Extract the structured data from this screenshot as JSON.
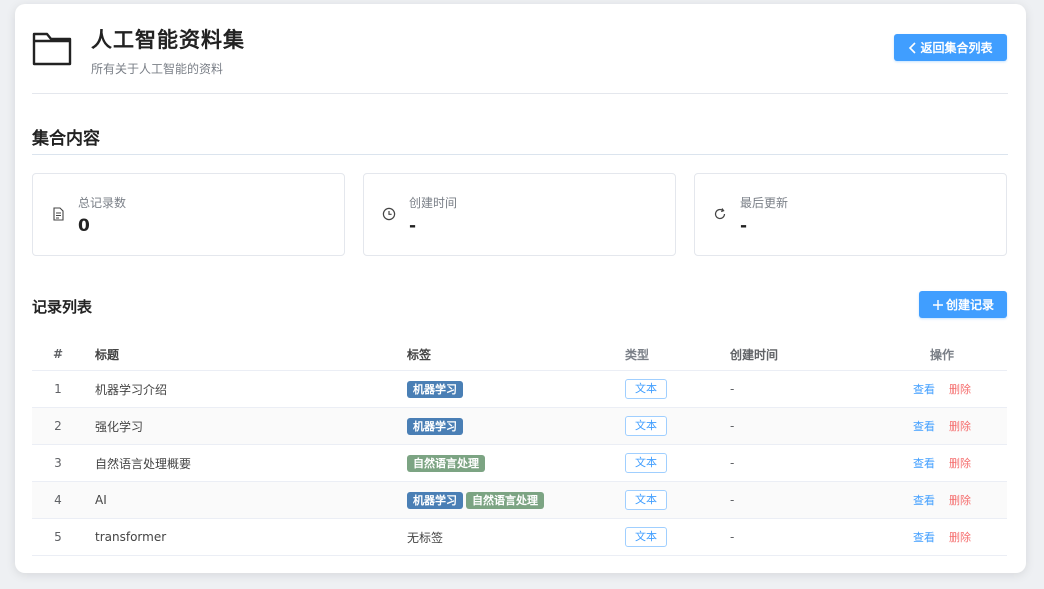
{
  "header": {
    "title": "人工智能资料集",
    "subtitle": "所有关于人工智能的资料",
    "back_label": "返回集合列表"
  },
  "section": {
    "title": "集合内容"
  },
  "stats": [
    {
      "label": "总记录数",
      "value": "0",
      "icon": "document-icon"
    },
    {
      "label": "创建时间",
      "value": "-",
      "icon": "clock-icon"
    },
    {
      "label": "最后更新",
      "value": "-",
      "icon": "refresh-icon"
    }
  ],
  "records": {
    "title": "记录列表",
    "create_label": "创建记录",
    "columns": [
      "#",
      "标题",
      "标签",
      "类型",
      "创建时间",
      "操作"
    ],
    "view_label": "查看",
    "delete_label": "删除",
    "rows": [
      {
        "idx": "1",
        "title": "机器学习介绍",
        "tags": [
          "机器学习"
        ],
        "no_tags": "",
        "type": "文本",
        "created": "-"
      },
      {
        "idx": "2",
        "title": "强化学习",
        "tags": [
          "机器学习"
        ],
        "no_tags": "",
        "type": "文本",
        "created": "-"
      },
      {
        "idx": "3",
        "title": "自然语言处理概要",
        "tags": [
          "自然语言处理"
        ],
        "no_tags": "",
        "type": "文本",
        "created": "-"
      },
      {
        "idx": "4",
        "title": "AI",
        "tags": [
          "机器学习",
          "自然语言处理"
        ],
        "no_tags": "",
        "type": "文本",
        "created": "-"
      },
      {
        "idx": "5",
        "title": "transformer",
        "tags": [],
        "no_tags": "无标签",
        "type": "文本",
        "created": "-"
      }
    ]
  },
  "colors": {
    "primary": "#409eff",
    "danger": "#f56c6c",
    "tag_ml": "#4a7fb5",
    "tag_nlp": "#7ca483"
  }
}
